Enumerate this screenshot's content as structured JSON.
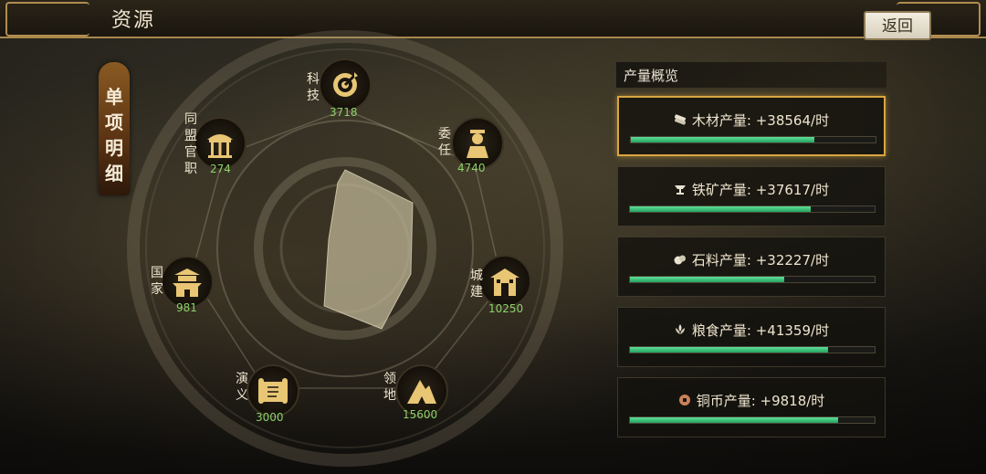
{
  "header": {
    "title": "资源",
    "back_label": "返回"
  },
  "side_tab": {
    "chars": [
      "单",
      "项",
      "明",
      "细"
    ]
  },
  "wheel": {
    "items": [
      {
        "key": "tech",
        "label": [
          "科",
          "技"
        ],
        "value": "3718",
        "icon": "target-gear-icon"
      },
      {
        "key": "appoint",
        "label": [
          "委",
          "任"
        ],
        "value": "4740",
        "icon": "official-figure-icon"
      },
      {
        "key": "build",
        "label": [
          "城",
          "建"
        ],
        "value": "10250",
        "icon": "building-hammer-icon"
      },
      {
        "key": "territory",
        "label": [
          "领",
          "地"
        ],
        "value": "15600",
        "icon": "mountain-icon"
      },
      {
        "key": "story",
        "label": [
          "演",
          "义"
        ],
        "value": "3000",
        "icon": "scroll-icon"
      },
      {
        "key": "nation",
        "label": [
          "国",
          "家"
        ],
        "value": "981",
        "icon": "palace-icon"
      },
      {
        "key": "alliance",
        "label": [
          "同",
          "盟",
          "官",
          "职"
        ],
        "value": "274",
        "icon": "pavilion-icon"
      }
    ]
  },
  "panel": {
    "title": "产量概览",
    "rows": [
      {
        "text": "木材产量: +38564/时",
        "icon": "wood-icon",
        "fill": 0.75,
        "selected": true
      },
      {
        "text": "铁矿产量: +37617/时",
        "icon": "anvil-icon",
        "fill": 0.74,
        "selected": false
      },
      {
        "text": "石料产量: +32227/时",
        "icon": "stone-icon",
        "fill": 0.63,
        "selected": false
      },
      {
        "text": "粮食产量: +41359/时",
        "icon": "grain-icon",
        "fill": 0.81,
        "selected": false
      },
      {
        "text": "铜币产量: +9818/时",
        "icon": "coin-icon",
        "fill": 0.85,
        "selected": false
      }
    ]
  }
}
